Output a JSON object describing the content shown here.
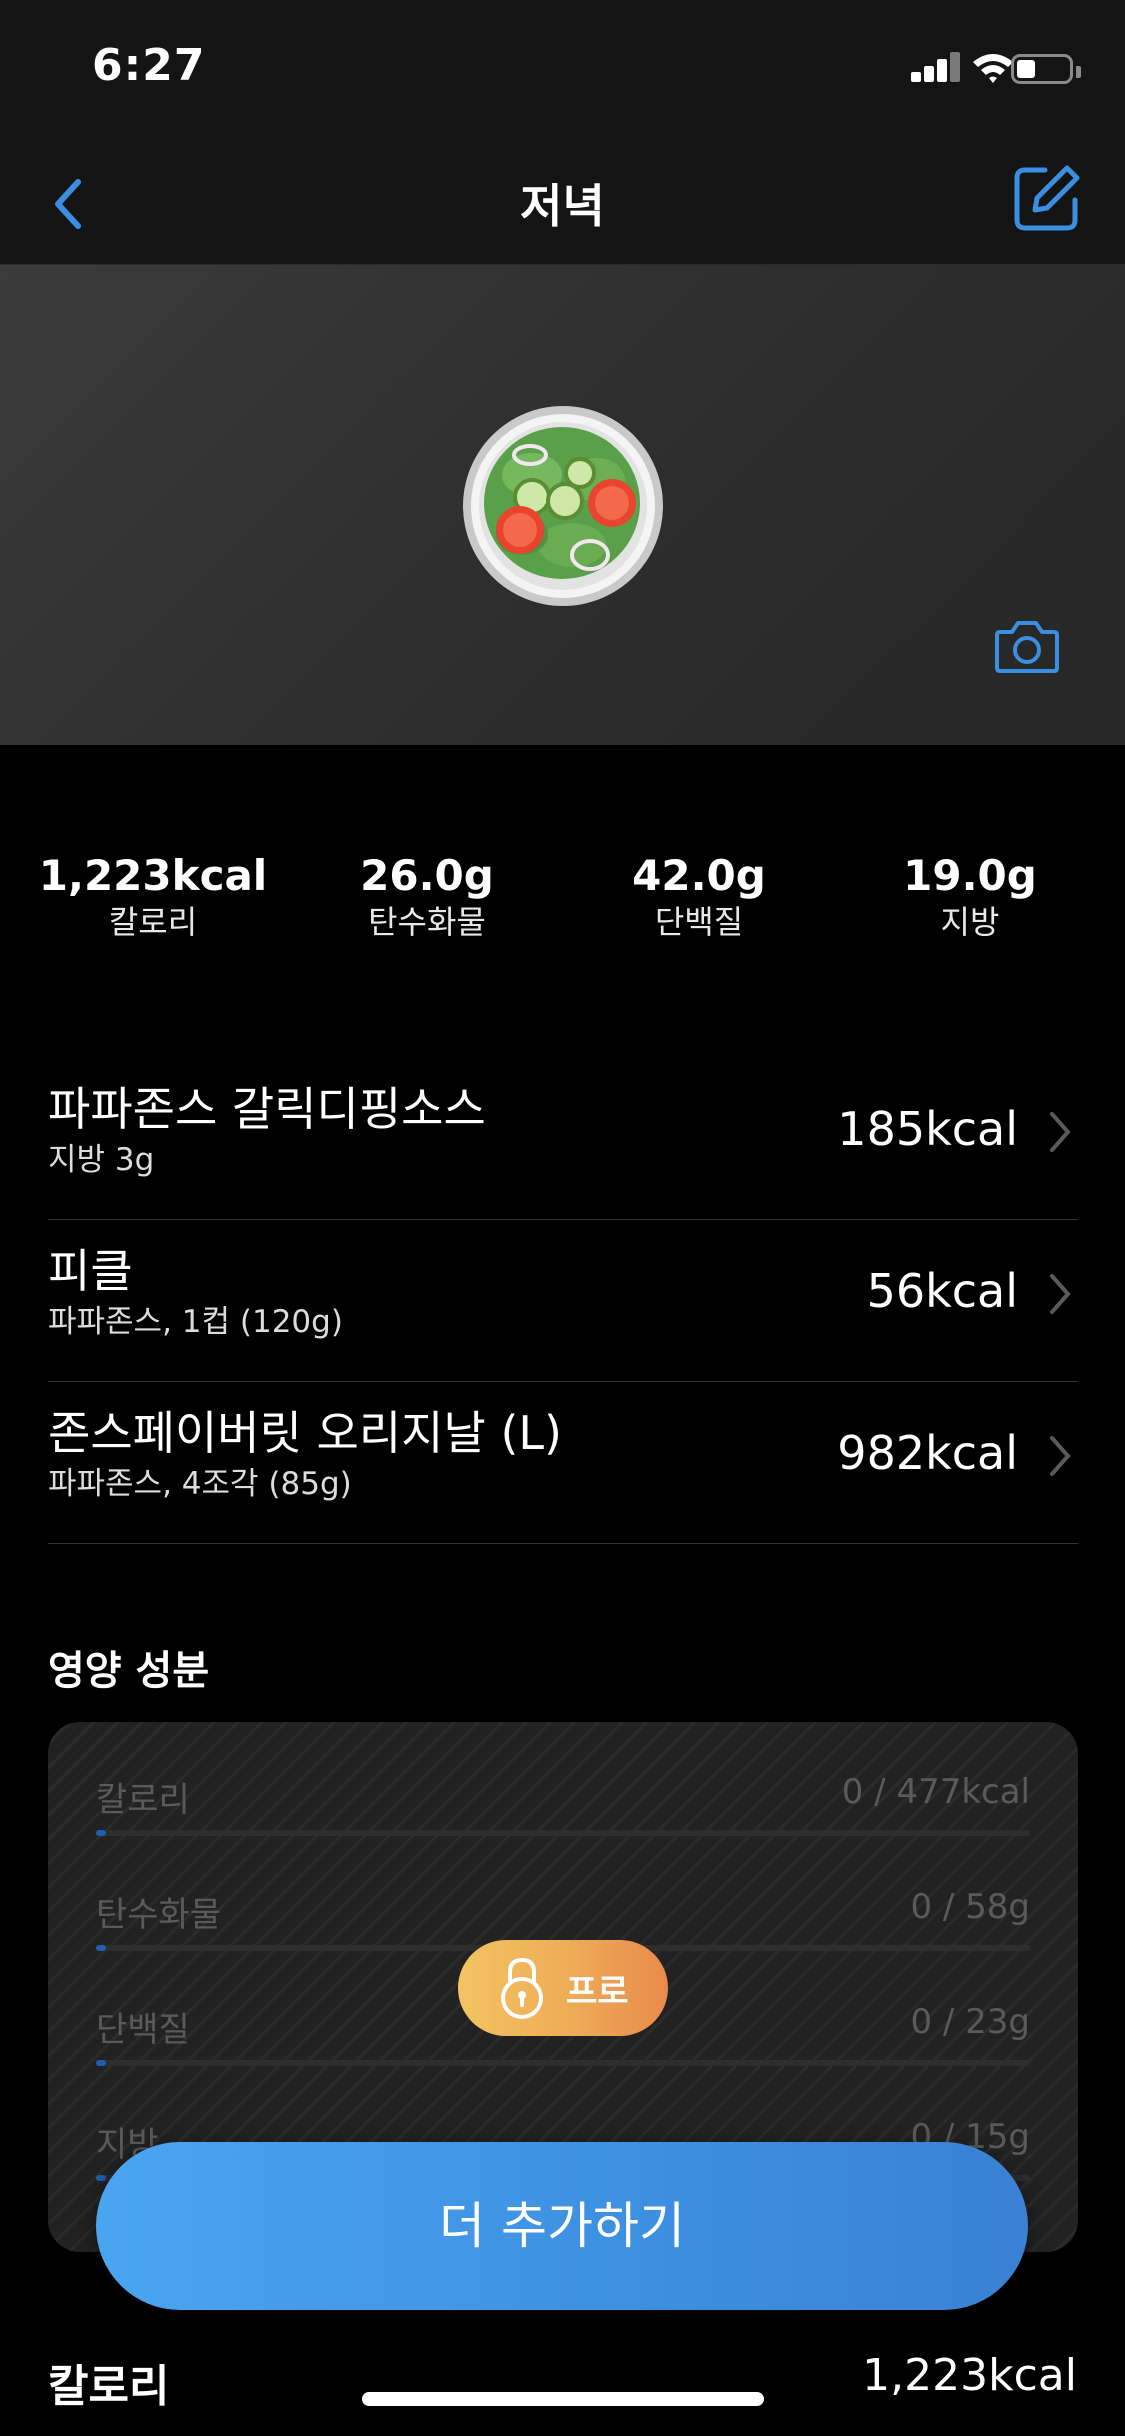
{
  "status_bar": {
    "time": "6:27",
    "signal_icon": "cellular-signal-icon",
    "wifi_icon": "wifi-icon",
    "battery_icon": "battery-icon",
    "battery_level": 0.35
  },
  "nav": {
    "title": "저녁",
    "back_icon": "chevron-left-icon",
    "edit_icon": "edit-icon",
    "accent_color": "#3a8fe0"
  },
  "hero": {
    "food_icon": "green-salad-icon",
    "camera_icon": "camera-icon"
  },
  "summary": [
    {
      "value": "1,223kcal",
      "label": "칼로리"
    },
    {
      "value": "26.0g",
      "label": "탄수화물"
    },
    {
      "value": "42.0g",
      "label": "단백질"
    },
    {
      "value": "19.0g",
      "label": "지방"
    }
  ],
  "foods": [
    {
      "name": "파파존스 갈릭디핑소스",
      "detail": "지방 3g",
      "kcal": "185kcal"
    },
    {
      "name": "피클",
      "detail": "파파존스, 1컵 (120g)",
      "kcal": "56kcal"
    },
    {
      "name": "존스페이버릿 오리지날 (L)",
      "detail": "파파존스, 4조각 (85g)",
      "kcal": "982kcal"
    }
  ],
  "nutrition": {
    "title": "영양 성분",
    "rows": [
      {
        "label": "칼로리",
        "value": "0 / 477kcal",
        "progress": 0
      },
      {
        "label": "탄수화물",
        "value": "0 / 58g",
        "progress": 0
      },
      {
        "label": "단백질",
        "value": "0 / 23g",
        "progress": 0
      },
      {
        "label": "지방",
        "value": "0 / 15g",
        "progress": 0
      }
    ],
    "locked": true
  },
  "pro_button": {
    "label": "프로",
    "icon": "lock-icon"
  },
  "add_more_button": {
    "label": "더 추가하기"
  },
  "footer": {
    "label": "칼로리",
    "value": "1,223kcal"
  }
}
